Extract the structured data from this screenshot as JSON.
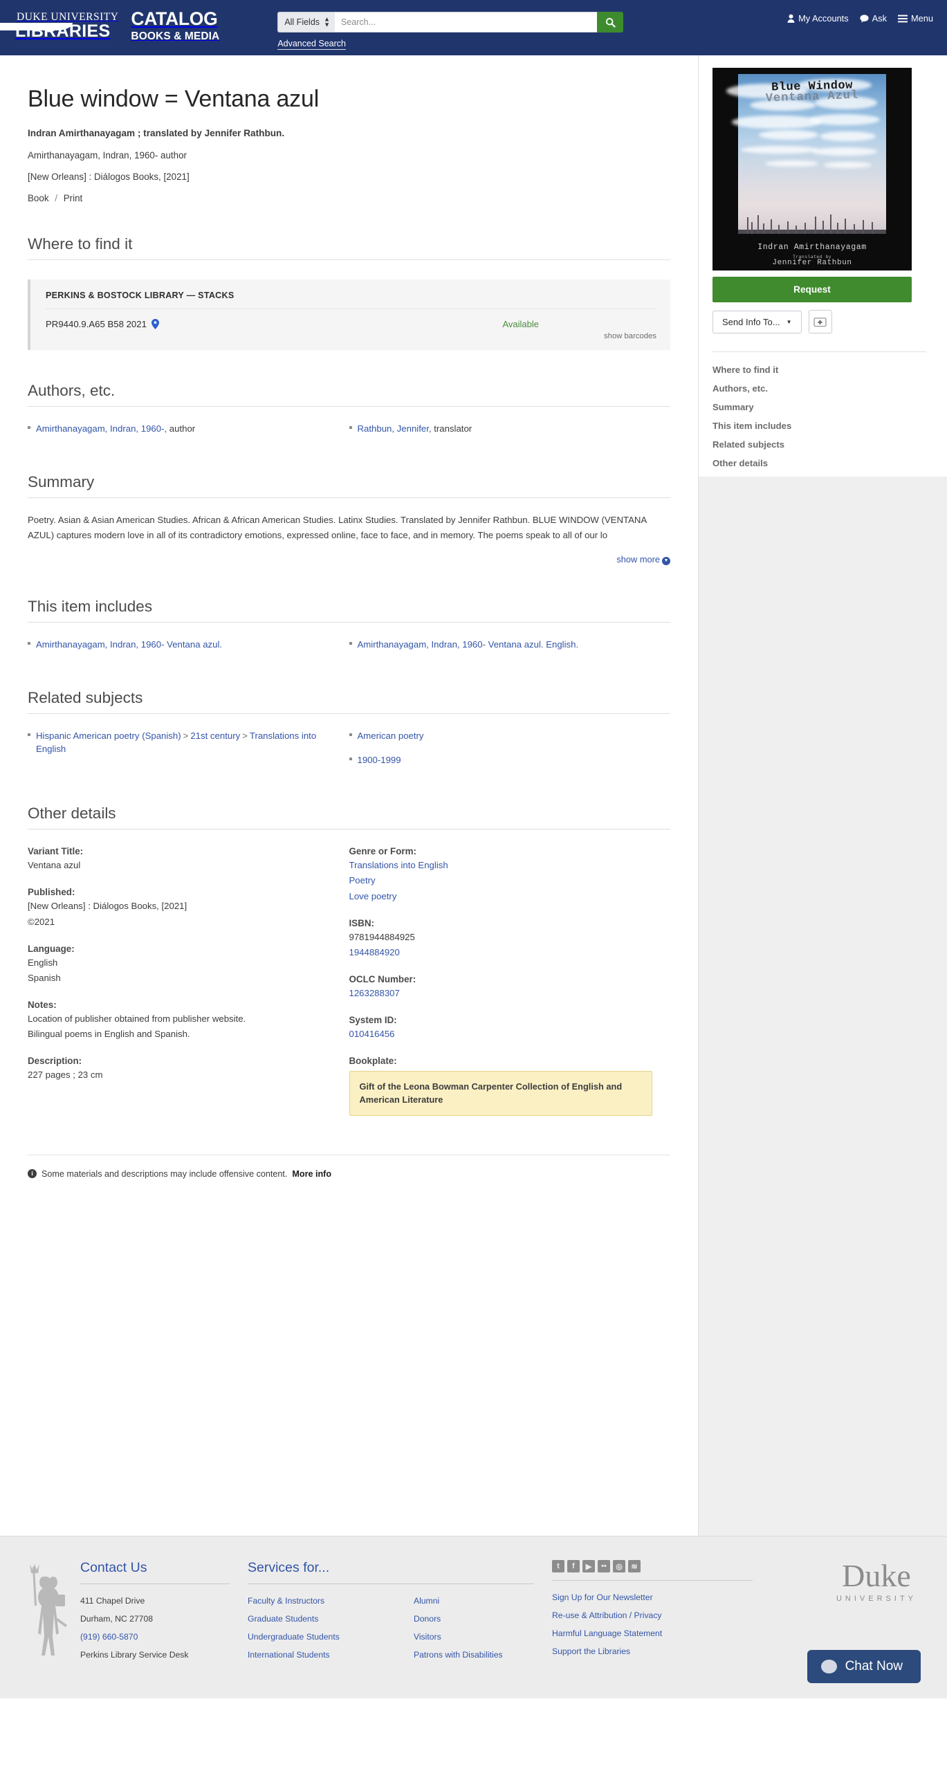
{
  "header": {
    "logo": {
      "line1": "DUKE UNIVERSITY",
      "line2": "LIBRARIES"
    },
    "catalog": {
      "line1": "CATALOG",
      "line2": "BOOKS & MEDIA"
    },
    "search": {
      "field_selected": "All Fields",
      "placeholder": "Search...",
      "button_icon": "search-icon",
      "advanced_label": "Advanced Search"
    },
    "links": [
      {
        "label": "My Accounts",
        "icon": "user-icon"
      },
      {
        "label": "Ask",
        "icon": "chat-icon"
      },
      {
        "label": "Menu",
        "icon": "hamburger-icon"
      }
    ]
  },
  "record": {
    "title": "Blue window = Ventana azul",
    "statement_of_responsibility": "Indran Amirthanayagam ; translated by Jennifer Rathbun.",
    "author_line": "Amirthanayagam, Indran, 1960- author",
    "publication_line": "[New Orleans] : Diálogos Books, [2021]",
    "format": "Book",
    "format_sep": "/",
    "medium": "Print"
  },
  "where_to_find_it": {
    "heading": "Where to find it",
    "library": "PERKINS & BOSTOCK LIBRARY — STACKS",
    "call_number": "PR9440.9.A65 B58 2021",
    "location_icon": "map-pin-icon",
    "status": "Available",
    "show_barcodes": "show barcodes"
  },
  "authors": {
    "heading": "Authors, etc.",
    "left": [
      {
        "name": "Amirthanayagam, Indran, 1960-,",
        "role": " author"
      }
    ],
    "right": [
      {
        "name": "Rathbun, Jennifer,",
        "role": " translator"
      }
    ]
  },
  "summary": {
    "heading": "Summary",
    "text": "Poetry. Asian & Asian American Studies. African & African American Studies. Latinx Studies. Translated by Jennifer Rathbun. BLUE WINDOW (VENTANA AZUL) captures modern love in all of its contradictory emotions, expressed online, face to face, and in memory. The poems speak to all of our lo",
    "show_more": "show more",
    "show_more_icon": "chevron-down-circle-icon"
  },
  "this_item_includes": {
    "heading": "This item includes",
    "left": [
      "Amirthanayagam, Indran, 1960- Ventana azul."
    ],
    "right": [
      "Amirthanayagam, Indran, 1960- Ventana azul. English."
    ]
  },
  "related_subjects": {
    "heading": "Related subjects",
    "left": [
      {
        "parts": [
          "Hispanic American poetry (Spanish)",
          "21st century",
          "Translations into English"
        ]
      }
    ],
    "right": [
      {
        "parts": [
          "American poetry"
        ]
      },
      {
        "parts": [
          "1900-1999"
        ]
      }
    ],
    "separator": ">"
  },
  "other_details": {
    "heading": "Other details",
    "left": [
      {
        "label": "Variant Title:",
        "values": [
          {
            "text": "Ventana azul",
            "link": false
          }
        ]
      },
      {
        "label": "Published:",
        "values": [
          {
            "text": "[New Orleans] : Diálogos Books, [2021]",
            "link": false
          },
          {
            "text": "©2021",
            "link": false
          }
        ]
      },
      {
        "label": "Language:",
        "values": [
          {
            "text": "English",
            "link": false
          },
          {
            "text": "Spanish",
            "link": false
          }
        ]
      },
      {
        "label": "Notes:",
        "values": [
          {
            "text": "Location of publisher obtained from publisher website.",
            "link": false
          },
          {
            "text": "Bilingual poems in English and Spanish.",
            "link": false
          }
        ]
      },
      {
        "label": "Description:",
        "values": [
          {
            "text": "227 pages ; 23 cm",
            "link": false
          }
        ]
      }
    ],
    "right": [
      {
        "label": "Genre or Form:",
        "values": [
          {
            "text": "Translations into English",
            "link": true
          },
          {
            "text": "Poetry",
            "link": true
          },
          {
            "text": "Love poetry",
            "link": true
          }
        ]
      },
      {
        "label": "ISBN:",
        "values": [
          {
            "text": "9781944884925",
            "link": false
          },
          {
            "text": "1944884920",
            "link": true
          }
        ]
      },
      {
        "label": "OCLC Number:",
        "values": [
          {
            "text": "1263288307",
            "link": true
          }
        ]
      },
      {
        "label": "System ID:",
        "values": [
          {
            "text": "010416456",
            "link": true
          }
        ]
      },
      {
        "label": "Bookplate:",
        "bookplate": "Gift of the Leona Bowman Carpenter Collection of English and American Literature"
      }
    ]
  },
  "offensive_notice": {
    "icon": "info-icon",
    "text": "Some materials and descriptions may include offensive content.",
    "link": "More info"
  },
  "sidebar": {
    "cover": {
      "title": "Blue Window",
      "subtitle": "Ventana Azul",
      "author": "Indran Amirthanayagam",
      "translated_by": "Translated by",
      "translator": "Jennifer Rathbun"
    },
    "request_label": "Request",
    "send_info_label": "Send Info To...",
    "send_info_icon": "caret-down-icon",
    "add_icon": "plus-folder-icon",
    "nav": [
      "Where to find it",
      "Authors, etc.",
      "Summary",
      "This item includes",
      "Related subjects",
      "Other details"
    ]
  },
  "footer": {
    "devil_icon": "blue-devil-icon",
    "contact": {
      "heading": "Contact Us",
      "lines": [
        {
          "text": "411 Chapel Drive",
          "link": false
        },
        {
          "text": "Durham, NC 27708",
          "link": false
        },
        {
          "text": "(919) 660-5870",
          "link": true
        },
        {
          "text": "Perkins Library Service Desk",
          "link": false
        }
      ]
    },
    "services": {
      "heading": "Services for...",
      "col1": [
        "Faculty & Instructors",
        "Graduate Students",
        "Undergraduate Students",
        "International Students"
      ],
      "col2": [
        "Alumni",
        "Donors",
        "Visitors",
        "Patrons with Disabilities"
      ]
    },
    "social": {
      "icons": [
        "twitter-icon",
        "facebook-icon",
        "youtube-icon",
        "flickr-icon",
        "instagram-icon",
        "rss-icon"
      ],
      "glyphs": [
        "t",
        "f",
        "▶",
        "••",
        "◎",
        "≋"
      ],
      "links": [
        "Sign Up for Our Newsletter",
        "Re-use & Attribution / Privacy",
        "Harmful Language Statement",
        "Support the Libraries"
      ]
    },
    "duke_wordmark": {
      "line1": "Duke",
      "line2": "UNIVERSITY"
    },
    "chat": {
      "label": "Chat Now",
      "icon": "chat-bubble-icon"
    }
  }
}
